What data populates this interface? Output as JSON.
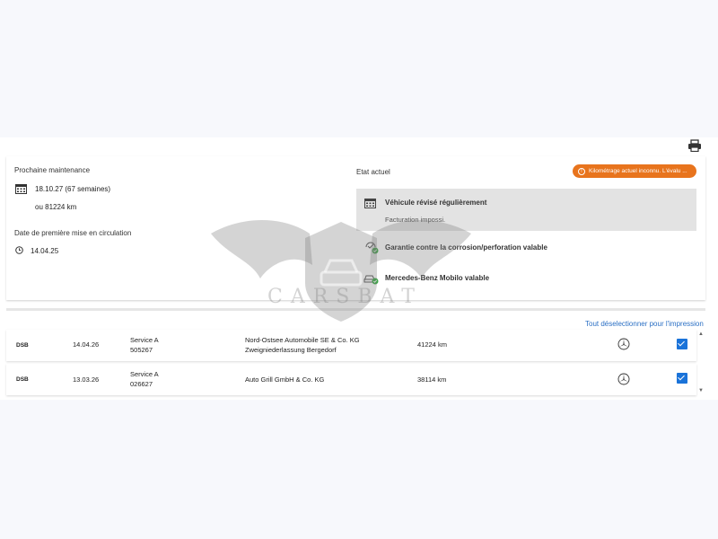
{
  "maintenance": {
    "label": "Prochaine maintenance",
    "date": "18.10.27 (67 semaines)",
    "km": "ou 81224 km",
    "first_registration_label": "Date de première mise en circulation",
    "first_registration_date": "14.04.25"
  },
  "status": {
    "label": "Etat actuel",
    "warning_badge": "Kilométrage actuel inconnu. L'évalu ...",
    "items": [
      {
        "title": "Véhicule révisé régulièrement",
        "subtitle": "Facturation impossi.",
        "icon": "calendar-icon"
      },
      {
        "title": "Garantie contre la corrosion/perforation valable",
        "icon": "check-shield-icon"
      },
      {
        "title": "Mercedes-Benz Mobilo valable",
        "icon": "car-check-icon"
      }
    ]
  },
  "watermark": {
    "text": "CARSBAT"
  },
  "history": {
    "deselect_link": "Tout déselectionner pour l'impression",
    "rows": [
      {
        "source": "DSB",
        "date": "14.04.26",
        "service": "Service A",
        "order": "505267",
        "workshop_line1": "Nord-Ostsee Automobile SE & Co. KG",
        "workshop_line2": "Zweigniederlassung Bergedorf",
        "mileage": "41224 km",
        "checked": true
      },
      {
        "source": "DSB",
        "date": "13.03.26",
        "service": "Service A",
        "order": "026627",
        "workshop_line1": "Auto Grill GmbH & Co. KG",
        "workshop_line2": "",
        "mileage": "38114 km",
        "checked": true
      }
    ]
  },
  "colors": {
    "accent_blue": "#1a73d9",
    "warning_orange": "#e8741d",
    "success_green": "#3aa845"
  }
}
